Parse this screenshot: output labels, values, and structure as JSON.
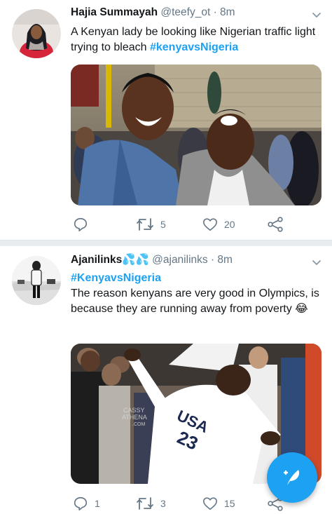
{
  "tweets": [
    {
      "name": "Hajia Summayah",
      "handle": "@teefy_ot",
      "time": "· 8m",
      "text": "A Kenyan lady be looking like Nigerian traffic light trying to bleach",
      "hashtag": "#kenyavsNigeria",
      "replies": "",
      "retweets": "5",
      "likes": "20"
    },
    {
      "name": "Ajanilinks",
      "emoji": "💦💦",
      "handle": "@ajanilinks",
      "time": "· 8m",
      "hashtag": "#KenyavsNigeria",
      "text": "The reason kenyans are very good in Olympics, is because they are running away from poverty 😂",
      "text_end": "😂",
      "watermark_line1": "CASSY",
      "watermark_line2": "ATHENA",
      "watermark_line3": ".COM",
      "jersey": "USA 23",
      "replies": "1",
      "retweets": "3",
      "likes": "15"
    }
  ],
  "colors": {
    "accent": "#1da1f2",
    "icon_gray": "#657786",
    "divider": "#e6ecf0"
  },
  "icons": [
    "reply-icon",
    "retweet-icon",
    "like-icon",
    "share-icon",
    "caret-down-icon",
    "compose-icon"
  ]
}
